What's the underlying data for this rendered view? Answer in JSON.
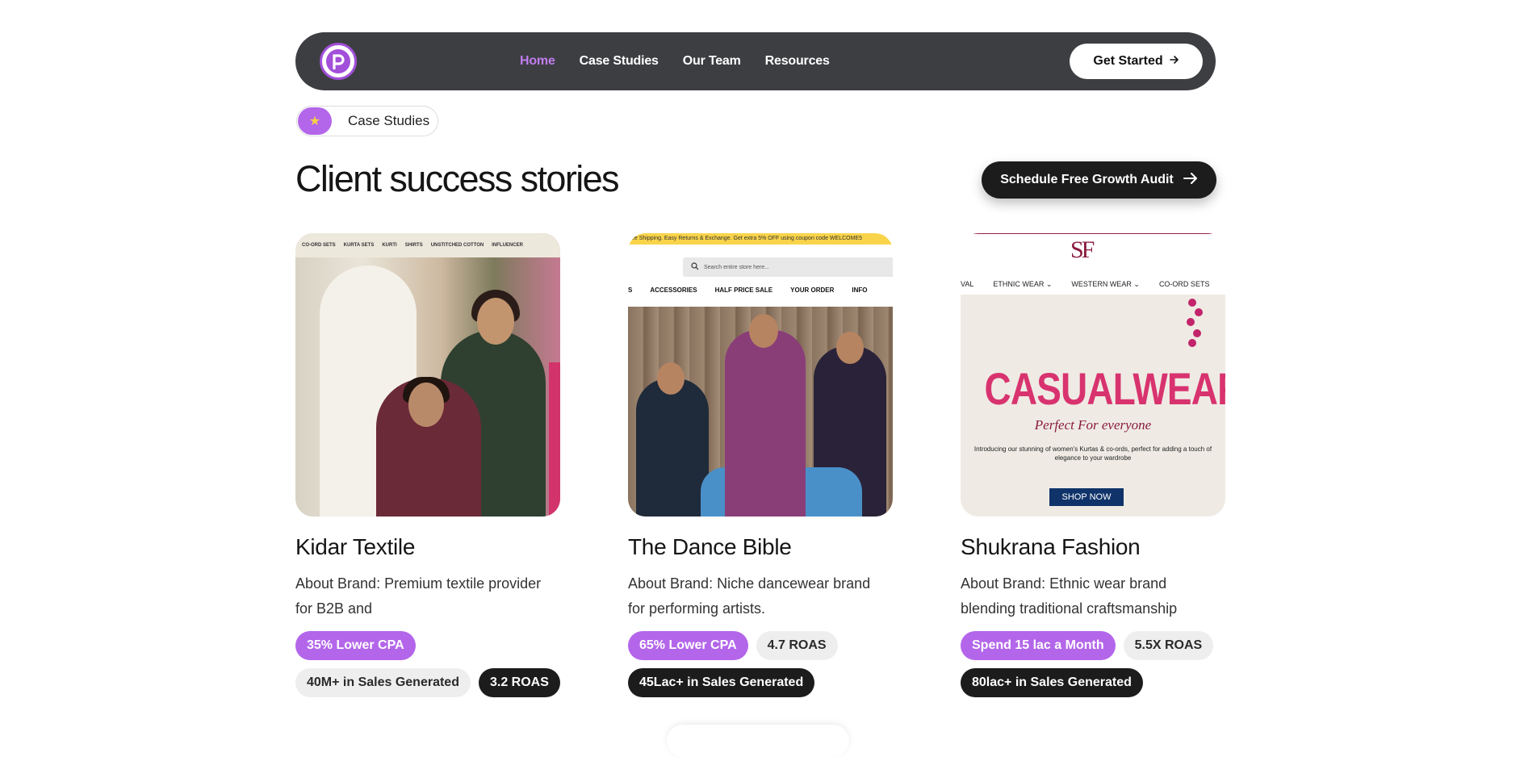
{
  "navbar": {
    "logo_icon": "p-logo-icon",
    "links": [
      {
        "label": "Home",
        "active": true
      },
      {
        "label": "Case Studies",
        "active": false
      },
      {
        "label": "Our Team",
        "active": false
      },
      {
        "label": "Resources",
        "active": false
      }
    ],
    "cta_label": "Get Started",
    "cta_icon": "arrow-right-icon"
  },
  "badge": {
    "icon": "star-icon",
    "label": "Case Studies"
  },
  "heading": {
    "title": "Client success stories",
    "audit_button": "Schedule Free Growth Audit",
    "audit_icon": "arrow-right-icon"
  },
  "cards": [
    {
      "name": "Kidar Textile",
      "about": "About Brand: Premium textile provider for B2B and",
      "image_nav": [
        "CO-ORD SETS",
        "KURTA SETS",
        "KURTI",
        "SHIRTS",
        "UNSTITCHED COTTON",
        "INFLUENCER"
      ],
      "tags": [
        {
          "label": "35% Lower CPA",
          "style": "purple"
        },
        {
          "label": "40M+ in Sales Generated",
          "style": "gray"
        },
        {
          "label": "3.2 ROAS",
          "style": "dark"
        }
      ]
    },
    {
      "name": "The Dance Bible",
      "about": "About Brand: Niche dancewear brand for performing artists.",
      "image_promo": "ee Shipping. Easy Returns & Exchange. Get extra 5% OFF using coupon code WELCOME5",
      "image_search": "Search entire store here...",
      "image_nav": [
        "S",
        "ACCESSORIES",
        "HALF PRICE SALE",
        "YOUR ORDER",
        "INFO"
      ],
      "tags": [
        {
          "label": "65% Lower CPA",
          "style": "purple"
        },
        {
          "label": "4.7 ROAS",
          "style": "gray"
        },
        {
          "label": "45Lac+ in Sales Generated",
          "style": "dark"
        }
      ]
    },
    {
      "name": "Shukrana Fashion",
      "about": "About Brand: Ethnic wear brand blending traditional craftsmanship",
      "image_logo": "SF",
      "image_nav": [
        "VAL",
        "ETHNIC WEAR ⌄",
        "WESTERN WEAR ⌄",
        "CO-ORD SETS"
      ],
      "image_headline": "CASUALWEAR",
      "image_tagline": "Perfect For everyone",
      "image_intro": "Introducing our stunning of women's Kurtas & co-ords, perfect for adding a touch of elegance to your wardrobe",
      "image_button": "SHOP NOW",
      "tags": [
        {
          "label": "Spend 15 lac a Month",
          "style": "purple"
        },
        {
          "label": "5.5X ROAS",
          "style": "gray"
        },
        {
          "label": "80lac+ in Sales Generated",
          "style": "dark"
        }
      ]
    }
  ],
  "colors": {
    "accent_purple": "#b366ea",
    "nav_active": "#c07dee",
    "nav_bg": "#3d3e42",
    "dark": "#1c1c1c"
  }
}
